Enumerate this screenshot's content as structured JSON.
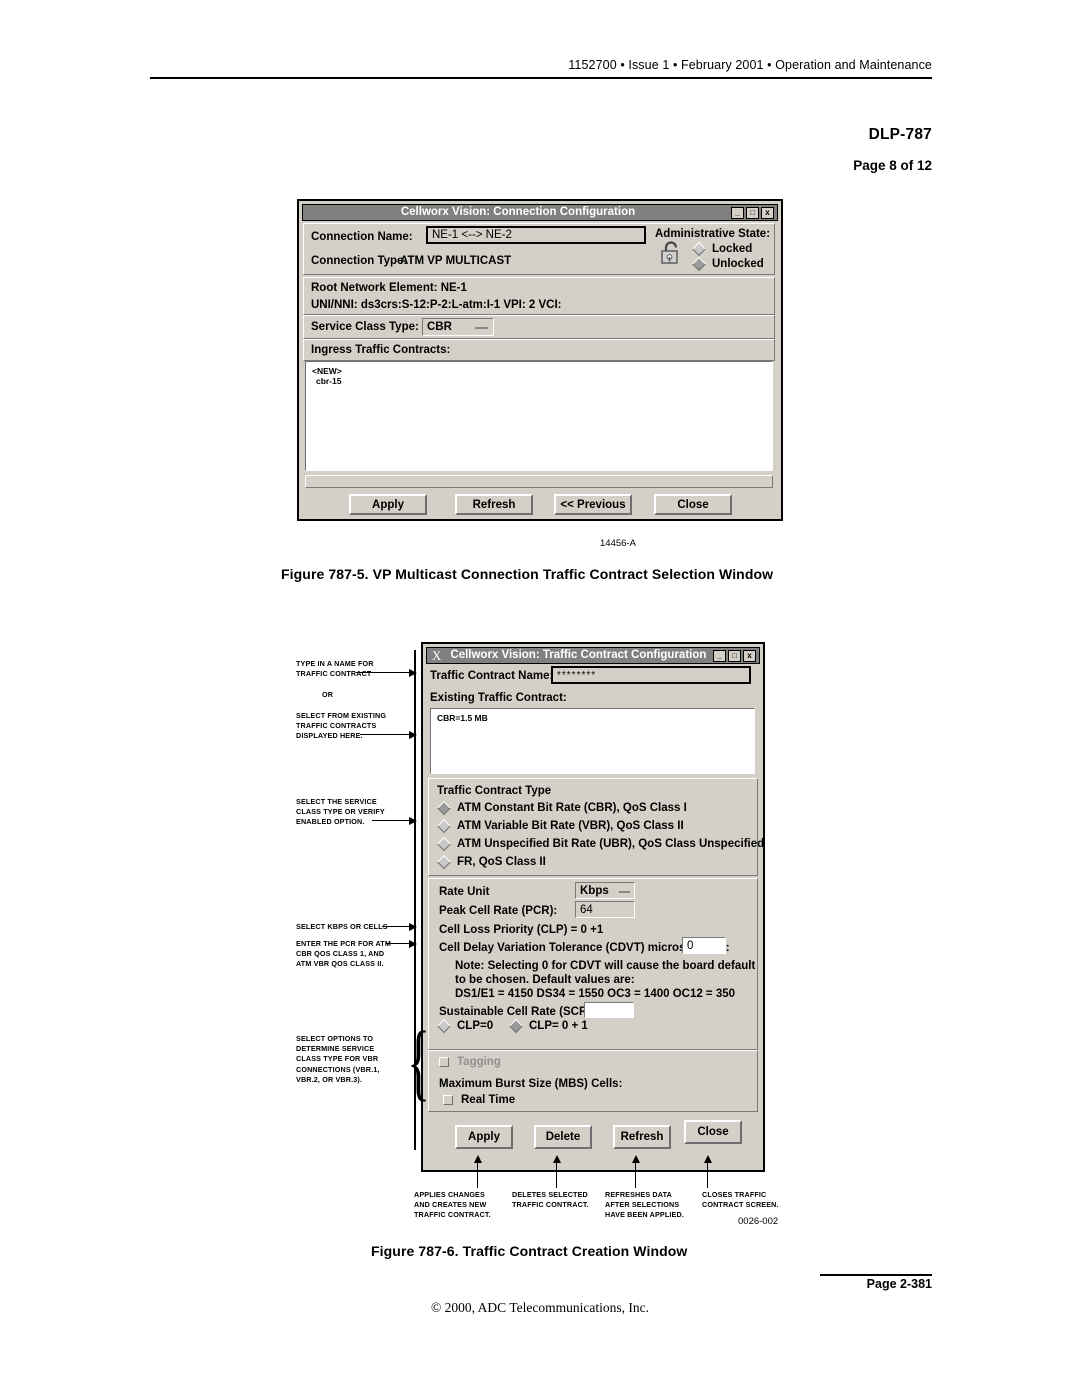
{
  "header": {
    "running_head": "1152700 • Issue 1 • February 2001 • Operation and Maintenance",
    "dlp": "DLP-787",
    "page_of": "Page 8 of 12"
  },
  "figure5": {
    "window": {
      "title": "Cellworx Vision: Connection Configuration",
      "min_label": "_",
      "max_label": "□",
      "close_label": "x",
      "connection_name_label": "Connection Name:",
      "connection_name_value": "NE-1 <--> NE-2",
      "connection_type_label": "Connection Type:",
      "connection_type_value": "ATM VP MULTICAST",
      "admin_state_label": "Administrative State:",
      "locked_label": "Locked",
      "unlocked_label": "Unlocked",
      "admin_state_selected": "Unlocked",
      "root_ne_label": "Root Network Element:  NE-1",
      "uni_nni_label": "UNI/NNI:  ds3crs:S-12:P-2:L-atm:I-1  VPI: 2  VCI:",
      "service_class_label": "Service Class Type:",
      "service_class_value": "CBR",
      "ingress_label": "Ingress Traffic Contracts:",
      "ingress_items": [
        "<NEW>",
        "cbr-15"
      ],
      "buttons": [
        "Apply",
        "Refresh",
        "<< Previous",
        "Close"
      ]
    },
    "fig_id": "14456-A",
    "caption": "Figure 787-5.  VP Multicast Connection Traffic Contract Selection Window"
  },
  "figure6": {
    "window": {
      "x_glyph": "X",
      "title": "Cellworx Vision: Traffic Contract Configuration",
      "min_label": "_",
      "max_label": "□",
      "close_label": "x",
      "contract_name_label": "Traffic Contract Name:",
      "contract_name_value": "********",
      "existing_label": "Existing Traffic Contract:",
      "existing_items": [
        "CBR=1.5 MB"
      ],
      "type_group_label": "Traffic Contract Type",
      "type_options": [
        {
          "label": "ATM Constant Bit Rate (CBR), QoS Class I",
          "selected": true
        },
        {
          "label": "ATM Variable Bit Rate (VBR), QoS Class II",
          "selected": false
        },
        {
          "label": "ATM  Unspecified Bit Rate (UBR), QoS Class Unspecified",
          "selected": false
        },
        {
          "label": "FR, QoS Class II",
          "selected": false
        }
      ],
      "rate_unit_label": "Rate Unit",
      "rate_unit_value": "Kbps",
      "pcr_label": "Peak Cell Rate (PCR):",
      "pcr_value": "64",
      "clp_label": "Cell Loss Priority (CLP) = 0 +1",
      "cdvt_label": "Cell Delay Variation Tolerance (CDVT) microseconds:",
      "cdvt_value": "0",
      "note_line1": "Note: Selecting 0 for CDVT will cause the board default",
      "note_line2": "to be chosen. Default values are:",
      "note_line3": "DS1/E1 = 4150   DS34 = 1550   OC3 = 1400   OC12 = 350",
      "scr_label": "Sustainable Cell Rate (SCR) :",
      "scr_value": "",
      "clp0_label": "CLP=0",
      "clp01_label": "CLP= 0 + 1",
      "clp_selected": "CLP= 0 + 1",
      "tagging_label": "Tagging",
      "tagging_enabled": false,
      "mbs_label": "Maximum Burst Size (MBS) Cells:",
      "realtime_label": "Real Time",
      "buttons": [
        "Apply",
        "Delete",
        "Refresh",
        "Close"
      ]
    },
    "callouts_left": [
      {
        "lines": [
          "TYPE IN A NAME FOR",
          " TRAFFIC CONTRACT"
        ]
      },
      {
        "lines": [
          "OR"
        ]
      },
      {
        "lines": [
          "SELECT FROM EXISTING",
          "TRAFFIC CONTRACTS",
          "DISPLAYED HERE."
        ]
      },
      {
        "lines": [
          "SELECT THE SERVICE",
          "CLASS TYPE OR VERIFY",
          "ENABLED OPTION."
        ]
      },
      {
        "lines": [
          "SELECT KBPS OR CELLS"
        ]
      },
      {
        "lines": [
          "ENTER THE PCR FOR ATM",
          "CBR QOS CLASS 1, AND",
          "ATM VBR QOS CLASS II."
        ]
      },
      {
        "lines": [
          "SELECT OPTIONS TO",
          "DETERMINE SERVICE",
          "CLASS TYPE FOR VBR",
          "CONNECTIONS (VBR.1,",
          "VBR.2, OR VBR.3)."
        ]
      }
    ],
    "callouts_bottom": [
      {
        "lines": [
          "APPLIES CHANGES",
          "AND CREATES NEW",
          "TRAFFIC CONTRACT."
        ]
      },
      {
        "lines": [
          "DELETES SELECTED",
          "TRAFFIC CONTRACT."
        ]
      },
      {
        "lines": [
          "REFRESHES DATA",
          "AFTER SELECTIONS",
          "HAVE BEEN APPLIED."
        ]
      },
      {
        "lines": [
          "CLOSES TRAFFIC",
          "CONTRACT SCREEN."
        ]
      }
    ],
    "fig_id": "0026-002",
    "caption": "Figure 787-6.  Traffic Contract Creation Window"
  },
  "footer": {
    "page": "Page 2-381",
    "copyright": "© 2000, ADC Telecommunications, Inc."
  }
}
